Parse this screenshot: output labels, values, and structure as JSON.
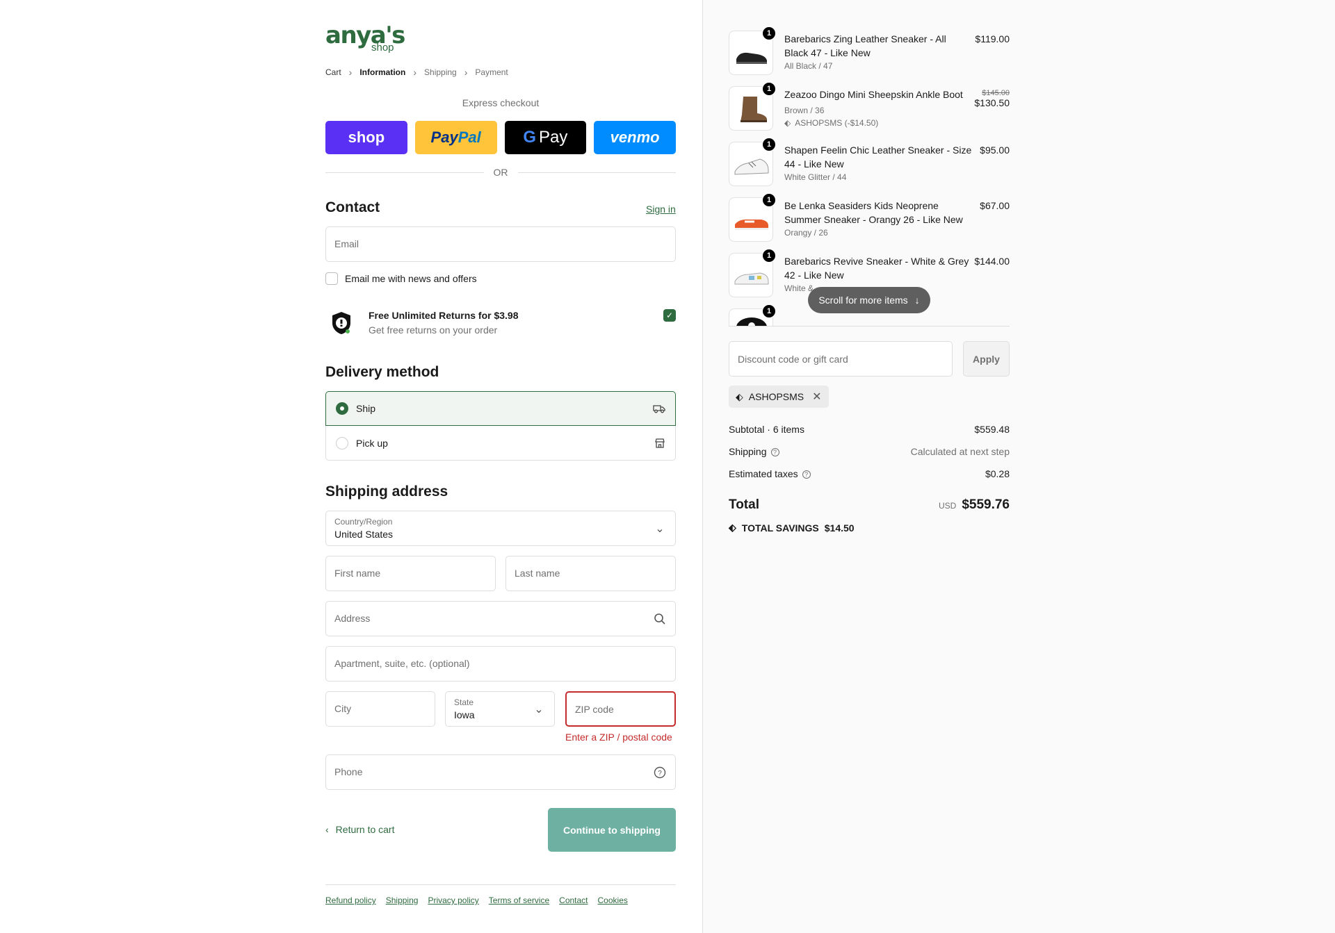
{
  "brand": {
    "name": "anya's",
    "sub": "shop"
  },
  "breadcrumb": {
    "cart": "Cart",
    "information": "Information",
    "shipping": "Shipping",
    "payment": "Payment"
  },
  "express": {
    "title": "Express checkout",
    "shop": "shop",
    "paypal_a": "Pay",
    "paypal_b": "Pal",
    "gpay_g": "G",
    "gpay": "Pay",
    "venmo": "venmo",
    "or": "OR"
  },
  "contact": {
    "title": "Contact",
    "sign_in": "Sign in",
    "email_placeholder": "Email",
    "newsletter": "Email me with news and offers"
  },
  "returns": {
    "title": "Free Unlimited Returns for $3.98",
    "subtitle": "Get free returns on your order",
    "checked": true
  },
  "delivery": {
    "title": "Delivery method",
    "ship": "Ship",
    "pickup": "Pick up",
    "selected": "Ship"
  },
  "shipping_address": {
    "title": "Shipping address",
    "country_label": "Country/Region",
    "country": "United States",
    "first_name": "First name",
    "last_name": "Last name",
    "address": "Address",
    "apartment": "Apartment, suite, etc. (optional)",
    "city": "City",
    "state_label": "State",
    "state": "Iowa",
    "zip": "ZIP code",
    "zip_error": "Enter a ZIP / postal code",
    "phone": "Phone"
  },
  "actions": {
    "return": "Return to cart",
    "continue": "Continue to shipping"
  },
  "footer": [
    "Refund policy",
    "Shipping",
    "Privacy policy",
    "Terms of service",
    "Contact",
    "Cookies"
  ],
  "cart": {
    "items": [
      {
        "qty": "1",
        "name": "Barebarics Zing Leather Sneaker - All Black 47 - Like New",
        "variant": "All Black / 47",
        "price": "$119.00"
      },
      {
        "qty": "1",
        "name": "Zeazoo Dingo Mini Sheepskin Ankle Boot",
        "variant": "Brown / 36",
        "discount": "ASHOPSMS (-$14.50)",
        "original_price": "$145.00",
        "price": "$130.50"
      },
      {
        "qty": "1",
        "name": "Shapen Feelin Chic Leather Sneaker - Size 44 - Like New",
        "variant": "White Glitter / 44",
        "price": "$95.00"
      },
      {
        "qty": "1",
        "name": "Be Lenka Seasiders Kids Neoprene Summer Sneaker - Orangy 26 - Like New",
        "variant": "Orangy / 26",
        "price": "$67.00"
      },
      {
        "qty": "1",
        "name": "Barebarics Revive Sneaker - White & Grey 42 - Like New",
        "variant": "White &",
        "price": "$144.00"
      },
      {
        "qty": "1"
      }
    ],
    "scroll_hint": "Scroll for more items",
    "discount_placeholder": "Discount code or gift card",
    "apply": "Apply",
    "applied_code": "ASHOPSMS",
    "subtotal_label": "Subtotal · 6 items",
    "subtotal": "$559.48",
    "shipping_label": "Shipping",
    "shipping": "Calculated at next step",
    "taxes_label": "Estimated taxes",
    "taxes": "$0.28",
    "total_label": "Total",
    "currency": "USD",
    "total": "$559.76",
    "savings_label": "TOTAL SAVINGS",
    "savings": "$14.50"
  },
  "colors": {
    "accent": "#2e6b3e",
    "error": "#c42b2b",
    "continue_btn": "#6eb1a2",
    "shop_pay": "#5a31f4",
    "paypal": "#ffc439",
    "venmo": "#008cff"
  }
}
